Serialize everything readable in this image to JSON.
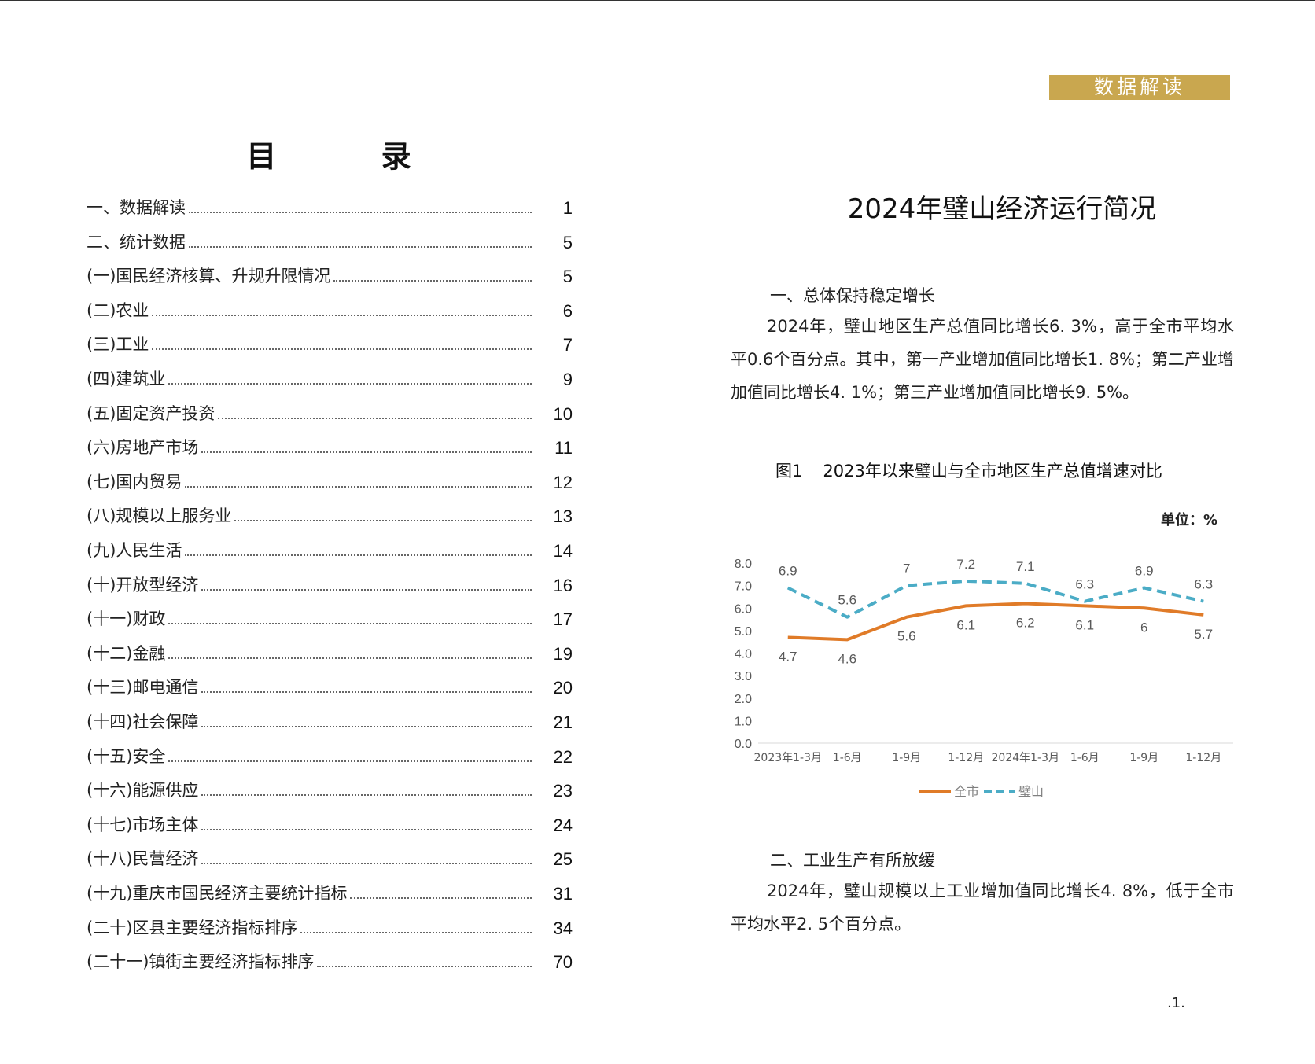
{
  "toc": {
    "title": "目 录",
    "items": [
      {
        "label": "一、数据解读",
        "page": "1"
      },
      {
        "label": "二、统计数据",
        "page": "5"
      },
      {
        "label": "(一)国民经济核算、升规升限情况",
        "page": "5"
      },
      {
        "label": "(二)农业",
        "page": "6"
      },
      {
        "label": "(三)工业",
        "page": "7"
      },
      {
        "label": "(四)建筑业",
        "page": "9"
      },
      {
        "label": "(五)固定资产投资",
        "page": "10"
      },
      {
        "label": "(六)房地产市场",
        "page": "11"
      },
      {
        "label": "(七)国内贸易",
        "page": "12"
      },
      {
        "label": "(八)规模以上服务业",
        "page": "13"
      },
      {
        "label": "(九)人民生活",
        "page": "14"
      },
      {
        "label": "(十)开放型经济",
        "page": "16"
      },
      {
        "label": "(十一)财政",
        "page": "17"
      },
      {
        "label": "(十二)金融",
        "page": "19"
      },
      {
        "label": "(十三)邮电通信",
        "page": "20"
      },
      {
        "label": "(十四)社会保障",
        "page": "21"
      },
      {
        "label": "(十五)安全",
        "page": "22"
      },
      {
        "label": "(十六)能源供应",
        "page": "23"
      },
      {
        "label": "(十七)市场主体",
        "page": "24"
      },
      {
        "label": "(十八)民营经济",
        "page": "25"
      },
      {
        "label": "(十九)重庆市国民经济主要统计指标",
        "page": "31"
      },
      {
        "label": "(二十)区县主要经济指标排序",
        "page": "34"
      },
      {
        "label": "(二十一)镇街主要经济指标排序",
        "page": "70"
      }
    ]
  },
  "article": {
    "badge": "数据解读",
    "title": "2024年璧山经济运行简况",
    "section1_heading": "一、总体保持稳定增长",
    "section1_text": "2024年，璧山地区生产总值同比增长6. 3%，高于全市平均水平0.6个百分点。其中，第一产业增加值同比增长1. 8%；第二产业增加值同比增长4. 1%；第三产业增加值同比增长9. 5%。",
    "figure_number": "图1",
    "figure_caption": "2023年以来璧山与全市地区生产总值增速对比",
    "unit": "单位：%",
    "section2_heading": "二、工业生产有所放缓",
    "section2_text": "2024年，璧山规模以上工业增加值同比增长4. 8%，低于全市平均水平2. 5个百分点。",
    "page_number": ".1."
  },
  "chart_data": {
    "type": "line",
    "categories": [
      "2023年1-3月",
      "1-6月",
      "1-9月",
      "1-12月",
      "2024年1-3月",
      "1-6月",
      "1-9月",
      "1-12月"
    ],
    "series": [
      {
        "name": "全市",
        "values": [
          4.7,
          4.6,
          5.6,
          6.1,
          6.2,
          6.1,
          6.0,
          5.7
        ],
        "color": "#e07b28",
        "style": "solid"
      },
      {
        "name": "璧山",
        "values": [
          6.9,
          5.6,
          7.0,
          7.2,
          7.1,
          6.3,
          6.9,
          6.3
        ],
        "color": "#4bacc6",
        "style": "dashed"
      }
    ],
    "ylim": [
      0,
      8
    ],
    "yticks": [
      "0.0",
      "1.0",
      "2.0",
      "3.0",
      "4.0",
      "5.0",
      "6.0",
      "7.0",
      "8.0"
    ],
    "legend": "bottom-center",
    "grid": false
  }
}
